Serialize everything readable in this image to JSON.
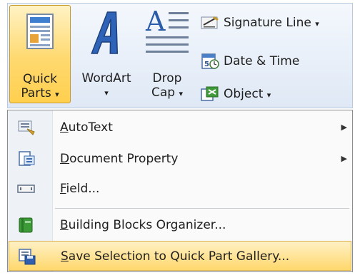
{
  "ribbon": {
    "quick_parts": {
      "line1": "Quick",
      "line2": "Parts",
      "arrow": "▾",
      "icon": "quick-parts-icon"
    },
    "wordart": {
      "label": "WordArt",
      "arrow": "▾",
      "icon": "wordart-icon"
    },
    "drop_cap": {
      "line1": "Drop",
      "line2": "Cap",
      "arrow": "▾",
      "icon": "drop-cap-icon"
    },
    "signature_line": {
      "label": "Signature Line",
      "arrow": "▾",
      "icon": "signature-line-icon"
    },
    "date_time": {
      "label": "Date & Time",
      "icon": "date-time-icon"
    },
    "object": {
      "label": "Object",
      "arrow": "▾",
      "icon": "object-icon"
    }
  },
  "menu": {
    "items": [
      {
        "key": "A",
        "rest": "utoText",
        "submenu": true,
        "icon": "autotext-icon"
      },
      {
        "key": "D",
        "rest": "ocument Property",
        "submenu": true,
        "icon": "document-property-icon"
      },
      {
        "key": "F",
        "rest": "ield...",
        "submenu": false,
        "icon": "field-icon"
      },
      {
        "key": "B",
        "rest": "uilding Blocks Organizer...",
        "submenu": false,
        "icon": "building-blocks-icon"
      },
      {
        "key": "S",
        "rest": "ave Selection to Quick Part Gallery...",
        "submenu": false,
        "icon": "save-selection-icon"
      }
    ]
  },
  "colors": {
    "highlight": "#ffd86c",
    "accent_blue": "#2a5caa"
  }
}
